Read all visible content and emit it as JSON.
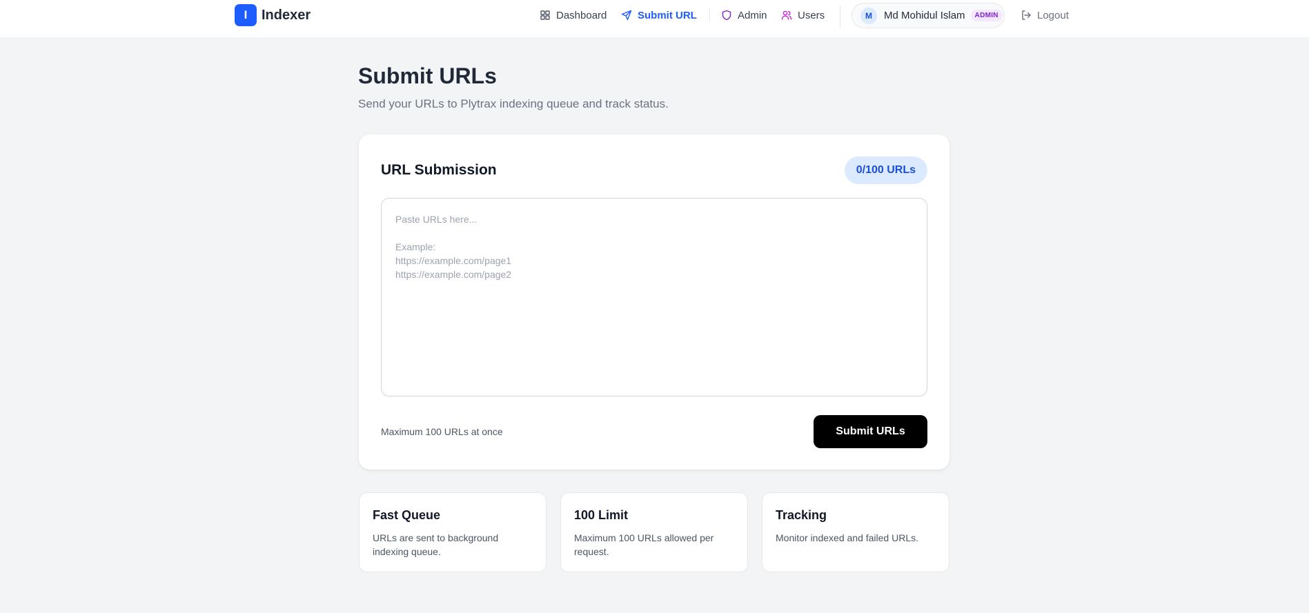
{
  "brand": {
    "logo_letter": "I",
    "name": "Indexer",
    "accent": "#1d5cff"
  },
  "nav": {
    "dashboard": {
      "label": "Dashboard",
      "icon": "dashboard-grid-icon"
    },
    "submit_url": {
      "label": "Submit URL",
      "icon": "send-icon",
      "active": true
    },
    "admin": {
      "label": "Admin",
      "icon": "shield-icon"
    },
    "users": {
      "label": "Users",
      "icon": "users-icon"
    }
  },
  "user": {
    "avatar_letter": "M",
    "name": "Md Mohidul Islam",
    "role": "ADMIN"
  },
  "logout": {
    "label": "Logout",
    "icon": "logout-icon"
  },
  "page": {
    "title": "Submit URLs",
    "subtitle": "Send your URLs to Plytrax indexing queue and track status."
  },
  "submission": {
    "title": "URL Submission",
    "count": "0/100 URLs",
    "placeholder": "Paste URLs here...\n\nExample:\nhttps://example.com/page1\nhttps://example.com/page2",
    "value": "",
    "helper": "Maximum 100 URLs at once",
    "submit_label": "Submit URLs"
  },
  "features": [
    {
      "title": "Fast Queue",
      "desc": "URLs are sent to background indexing queue."
    },
    {
      "title": "100 Limit",
      "desc": "Maximum 100 URLs allowed per request."
    },
    {
      "title": "Tracking",
      "desc": "Monitor indexed and failed URLs."
    }
  ]
}
